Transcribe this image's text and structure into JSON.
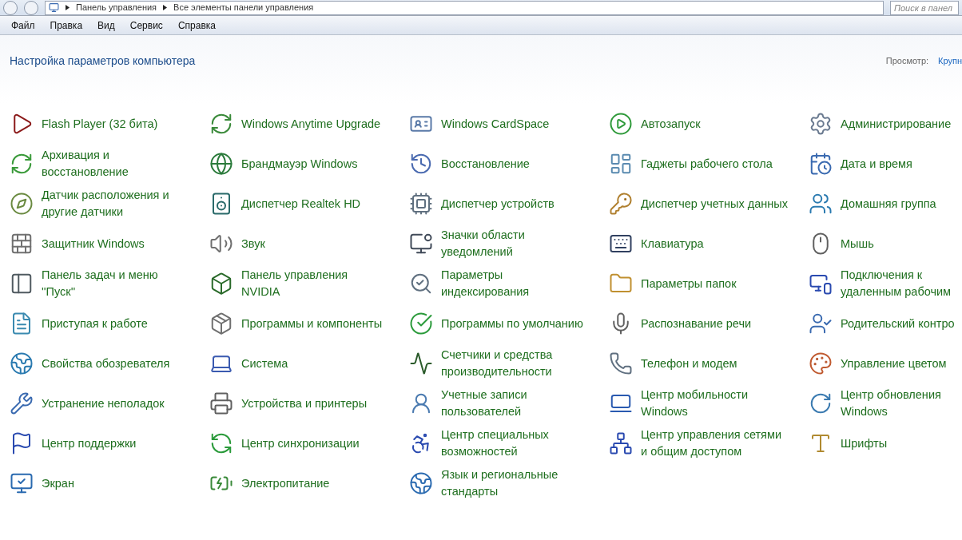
{
  "address_bar": {
    "breadcrumbs": [
      "Панель управления",
      "Все элементы панели управления"
    ],
    "search": {
      "placeholder": "Поиск в панел"
    }
  },
  "menu_bar": [
    "Файл",
    "Правка",
    "Вид",
    "Сервис",
    "Справка"
  ],
  "header": {
    "title": "Настройка параметров компьютера",
    "view_label": "Просмотр:",
    "view_value": "Крупн"
  },
  "items": [
    {
      "label": "Flash Player (32 бита)"
    },
    {
      "label": "Windows Anytime Upgrade"
    },
    {
      "label": "Windows CardSpace"
    },
    {
      "label": "Автозапуск"
    },
    {
      "label": "Администрирование"
    },
    {
      "label": "Архивация и восстановление"
    },
    {
      "label": "Брандмауэр Windows"
    },
    {
      "label": "Восстановление"
    },
    {
      "label": "Гаджеты рабочего стола"
    },
    {
      "label": "Дата и время"
    },
    {
      "label": "Датчик расположения и другие датчики"
    },
    {
      "label": "Диспетчер Realtek HD"
    },
    {
      "label": "Диспетчер устройств"
    },
    {
      "label": "Диспетчер учетных данных"
    },
    {
      "label": "Домашняя группа"
    },
    {
      "label": "Защитник Windows"
    },
    {
      "label": "Звук"
    },
    {
      "label": "Значки области уведомлений"
    },
    {
      "label": "Клавиатура"
    },
    {
      "label": "Мышь"
    },
    {
      "label": "Панель задач и меню ''Пуск''"
    },
    {
      "label": "Панель управления NVIDIA"
    },
    {
      "label": "Параметры индексирования"
    },
    {
      "label": "Параметры папок"
    },
    {
      "label": "Подключения к удаленным рабочим"
    },
    {
      "label": "Приступая к работе"
    },
    {
      "label": "Программы и компоненты"
    },
    {
      "label": "Программы по умолчанию"
    },
    {
      "label": "Распознавание речи"
    },
    {
      "label": "Родительский контро"
    },
    {
      "label": "Свойства обозревателя"
    },
    {
      "label": "Система"
    },
    {
      "label": "Счетчики и средства производительности"
    },
    {
      "label": "Телефон и модем"
    },
    {
      "label": "Управление цветом"
    },
    {
      "label": "Устранение неполадок"
    },
    {
      "label": "Устройства и принтеры"
    },
    {
      "label": "Учетные записи пользователей"
    },
    {
      "label": "Центр мобильности Windows"
    },
    {
      "label": "Центр обновления Windows"
    },
    {
      "label": "Центр поддержки"
    },
    {
      "label": "Центр синхронизации"
    },
    {
      "label": "Центр специальных возможностей"
    },
    {
      "label": "Центр управления сетями и общим доступом"
    },
    {
      "label": "Шрифты"
    },
    {
      "label": "Экран"
    },
    {
      "label": "Электропитание"
    },
    {
      "label": "Язык и региональные стандарты"
    }
  ]
}
